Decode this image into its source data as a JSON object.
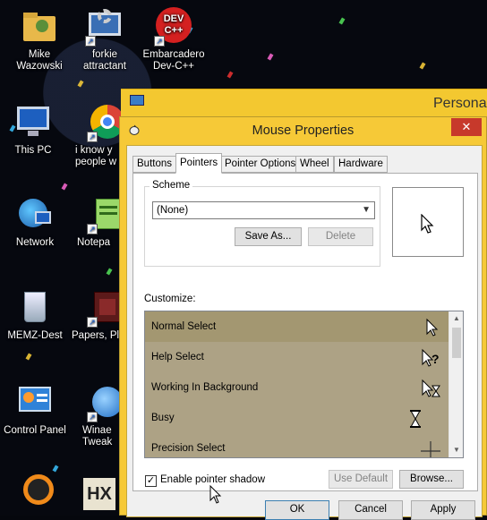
{
  "desktop": {
    "icons": [
      {
        "label": "Mike\nWazowski",
        "icon": "folder-user-icon"
      },
      {
        "label": "forkie\nattractant",
        "icon": "settings-monitor-icon"
      },
      {
        "label": "Embarcadero\nDev-C++",
        "icon": "devcpp-icon"
      },
      {
        "label": "This PC",
        "icon": "computer-icon"
      },
      {
        "label": "i know y\npeople w",
        "icon": "chrome-icon"
      },
      {
        "label": "Network",
        "icon": "network-icon"
      },
      {
        "label": "Notepa",
        "icon": "notepad-icon"
      },
      {
        "label": "MEMZ-Dest",
        "icon": "recycle-bin-icon"
      },
      {
        "label": "Papers, Pl",
        "icon": "papers-icon"
      },
      {
        "label": "Control Panel",
        "icon": "control-panel-icon"
      },
      {
        "label": "Winae\nTweak",
        "icon": "winaero-icon"
      }
    ]
  },
  "personalization": {
    "title": "Personali"
  },
  "dialog": {
    "title": "Mouse Properties",
    "close_glyph": "✕",
    "tabs": [
      "Buttons",
      "Pointers",
      "Pointer Options",
      "Wheel",
      "Hardware"
    ],
    "active_tab": "Pointers",
    "scheme": {
      "label": "Scheme",
      "selected": "(None)",
      "save_as": "Save As...",
      "delete": "Delete"
    },
    "customize_label": "Customize:",
    "cursors": [
      {
        "name": "Normal Select",
        "icon": "arrow-cursor-icon"
      },
      {
        "name": "Help Select",
        "icon": "help-cursor-icon"
      },
      {
        "name": "Working In Background",
        "icon": "working-cursor-icon"
      },
      {
        "name": "Busy",
        "icon": "hourglass-cursor-icon"
      },
      {
        "name": "Precision Select",
        "icon": "crosshair-cursor-icon"
      }
    ],
    "enable_shadow_label": "Enable pointer shadow",
    "enable_shadow_checked": true,
    "use_default": "Use Default",
    "browse": "Browse...",
    "ok": "OK",
    "cancel": "Cancel",
    "apply": "Apply"
  },
  "colors": {
    "dialog_frame": "#f6c937",
    "selected_row": "#a39771",
    "row_bg": "#ada285",
    "close_red": "#c7392b"
  }
}
